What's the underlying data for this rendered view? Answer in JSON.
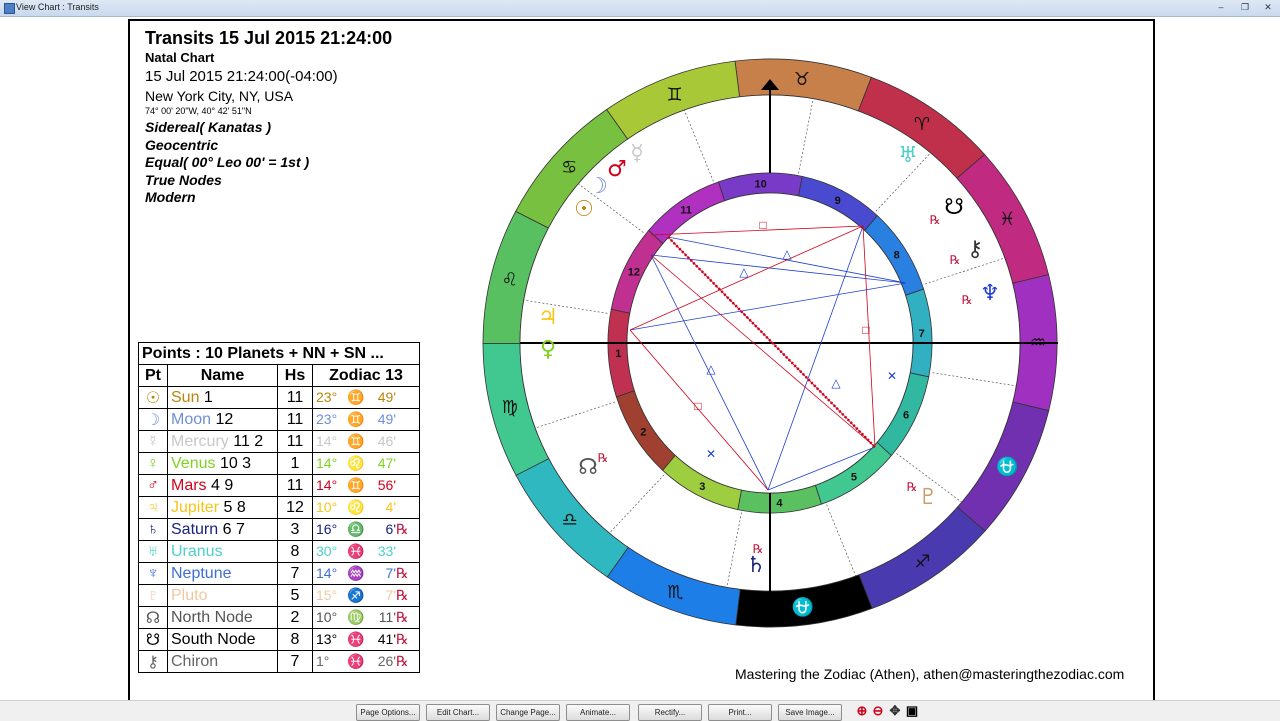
{
  "window": {
    "title": "View Chart : Transits",
    "controls": [
      "–",
      "❐",
      "✕"
    ]
  },
  "header": {
    "title": "Transits 15 Jul 2015 21:24:00",
    "subtitle": "Natal Chart",
    "datetime": "15 Jul 2015 21:24:00(-04:00)",
    "location": "New York City, NY, USA",
    "coords": "74° 00' 20\"W, 40° 42' 51\"N",
    "zodiac": "Sidereal( Kanatas )",
    "centric": "Geocentric",
    "houses": "Equal( 00° Leo 00' = 1st )",
    "nodes": "True Nodes",
    "mode": "Modern"
  },
  "table": {
    "caption": "Points : 10 Planets + NN + SN ...",
    "headers": [
      "Pt",
      "Name",
      "Hs",
      "Zodiac 13"
    ],
    "rows": [
      {
        "glyph": "☉",
        "name": "Sun",
        "extra": "1",
        "house": "11",
        "deg": "23°",
        "sign": "♊",
        "min": "49'",
        "rx": "",
        "color": "#b8860b"
      },
      {
        "glyph": "☽",
        "name": "Moon",
        "extra": "12",
        "house": "11",
        "deg": "23°",
        "sign": "♊",
        "min": "49'",
        "rx": "",
        "color": "#6f8fd8"
      },
      {
        "glyph": "☿",
        "name": "Mercury",
        "extra": "11 2",
        "house": "11",
        "deg": "14°",
        "sign": "♊",
        "min": "46'",
        "rx": "",
        "color": "#c8c8c8"
      },
      {
        "glyph": "♀",
        "name": "Venus",
        "extra": "10 3",
        "house": "1",
        "deg": "14°",
        "sign": "♌",
        "min": "47'",
        "rx": "",
        "color": "#7ed321"
      },
      {
        "glyph": "♂",
        "name": "Mars",
        "extra": "4 9",
        "house": "11",
        "deg": "14°",
        "sign": "♊",
        "min": "56'",
        "rx": "",
        "color": "#d0021b"
      },
      {
        "glyph": "♃",
        "name": "Jupiter",
        "extra": "5 8",
        "house": "12",
        "deg": "10°",
        "sign": "♌",
        "min": "4'",
        "rx": "",
        "color": "#f5c518"
      },
      {
        "glyph": "♄",
        "name": "Saturn",
        "extra": "6 7",
        "house": "3",
        "deg": "16°",
        "sign": "♎",
        "min": "6'",
        "rx": "℞",
        "color": "#1a237e"
      },
      {
        "glyph": "♅",
        "name": "Uranus",
        "extra": "",
        "house": "8",
        "deg": "30°",
        "sign": "♓",
        "min": "33'",
        "rx": "",
        "color": "#4dd0c8"
      },
      {
        "glyph": "♆",
        "name": "Neptune",
        "extra": "",
        "house": "7",
        "deg": "14°",
        "sign": "♒",
        "min": "7'",
        "rx": "℞",
        "color": "#3f6fd0"
      },
      {
        "glyph": "♇",
        "name": "Pluto",
        "extra": "",
        "house": "5",
        "deg": "15°",
        "sign": "♐",
        "min": "7'",
        "rx": "℞",
        "color": "#f0c8a0"
      },
      {
        "glyph": "☊",
        "name": "North Node",
        "extra": "",
        "house": "2",
        "deg": "10°",
        "sign": "♍",
        "min": "11'",
        "rx": "℞",
        "color": "#555555"
      },
      {
        "glyph": "☋",
        "name": "South Node",
        "extra": "",
        "house": "8",
        "deg": "13°",
        "sign": "♓",
        "min": "41'",
        "rx": "℞",
        "color": "#000000"
      },
      {
        "glyph": "⚷",
        "name": "Chiron",
        "extra": "",
        "house": "7",
        "deg": "1°",
        "sign": "♓",
        "min": "26'",
        "rx": "℞",
        "color": "#666666"
      }
    ]
  },
  "wheel": {
    "signs": [
      {
        "glyph": "♉",
        "color": "#c8804a"
      },
      {
        "glyph": "♈",
        "color": "#c0304a"
      },
      {
        "glyph": "♓",
        "color": "#c02a80"
      },
      {
        "glyph": "♒",
        "color": "#a030c0"
      },
      {
        "glyph": "⛎",
        "color": "#7030b0"
      },
      {
        "glyph": "♐",
        "color": "#4a3ab0"
      },
      {
        "glyph": "⛎",
        "color": "#000000"
      },
      {
        "glyph": "♏",
        "color": "#1e7ee8"
      },
      {
        "glyph": "♎",
        "color": "#30b8c0"
      },
      {
        "glyph": "♍",
        "color": "#40c890"
      },
      {
        "glyph": "♌",
        "color": "#58c060"
      },
      {
        "glyph": "♋",
        "color": "#78c040"
      },
      {
        "glyph": "♊",
        "color": "#a8c838"
      }
    ],
    "houses": [
      "1",
      "2",
      "3",
      "4",
      "5",
      "6",
      "7",
      "8",
      "9",
      "10",
      "11",
      "12"
    ],
    "retro": "℞",
    "glyphs": [
      "♅",
      "☋",
      "⚷",
      "♆",
      "♇",
      "☊",
      "♃",
      "♀",
      "☉",
      "☽",
      "♂",
      "☿",
      "♄"
    ]
  },
  "footer": "Mastering the Zodiac (Athen), athen@masteringthezodiac.com",
  "buttons": [
    "Page Options...",
    "Edit Chart...",
    "Change Page...",
    "Animate...",
    "Rectify...",
    "Print...",
    "Save Image..."
  ],
  "zoom_icons": [
    "zoom-in",
    "zoom-out",
    "pan",
    "fit"
  ]
}
